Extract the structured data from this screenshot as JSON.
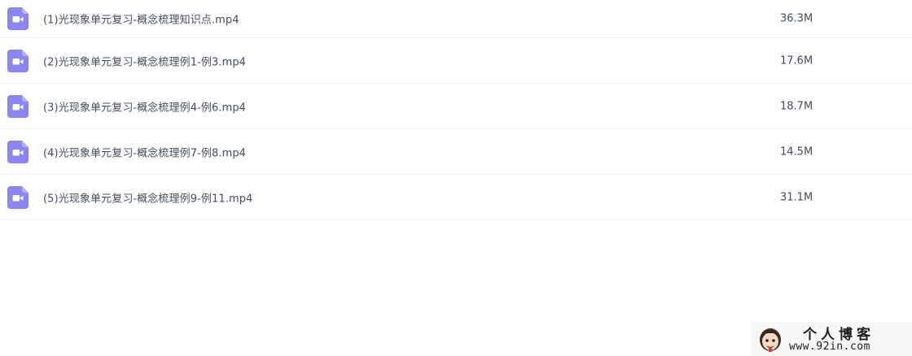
{
  "files": [
    {
      "icon": "video-file-icon",
      "name": "(1)光现象单元复习-概念梳理知识点.mp4",
      "size": "36.3M"
    },
    {
      "icon": "video-file-icon",
      "name": "(2)光现象单元复习-概念梳理例1-例3.mp4",
      "size": "17.6M"
    },
    {
      "icon": "video-file-icon",
      "name": "(3)光现象单元复习-概念梳理例4-例6.mp4",
      "size": "18.7M"
    },
    {
      "icon": "video-file-icon",
      "name": "(4)光现象单元复习-概念梳理例7-例8.mp4",
      "size": "14.5M"
    },
    {
      "icon": "video-file-icon",
      "name": "(5)光现象单元复习-概念梳理例9-例11.mp4",
      "size": "31.1M"
    }
  ],
  "colors": {
    "icon_bg": "#8a85f3",
    "text": "#454d5a",
    "divider": "#eef0f4"
  },
  "watermark": {
    "title": "个人博客",
    "url": "www.92in.com"
  }
}
